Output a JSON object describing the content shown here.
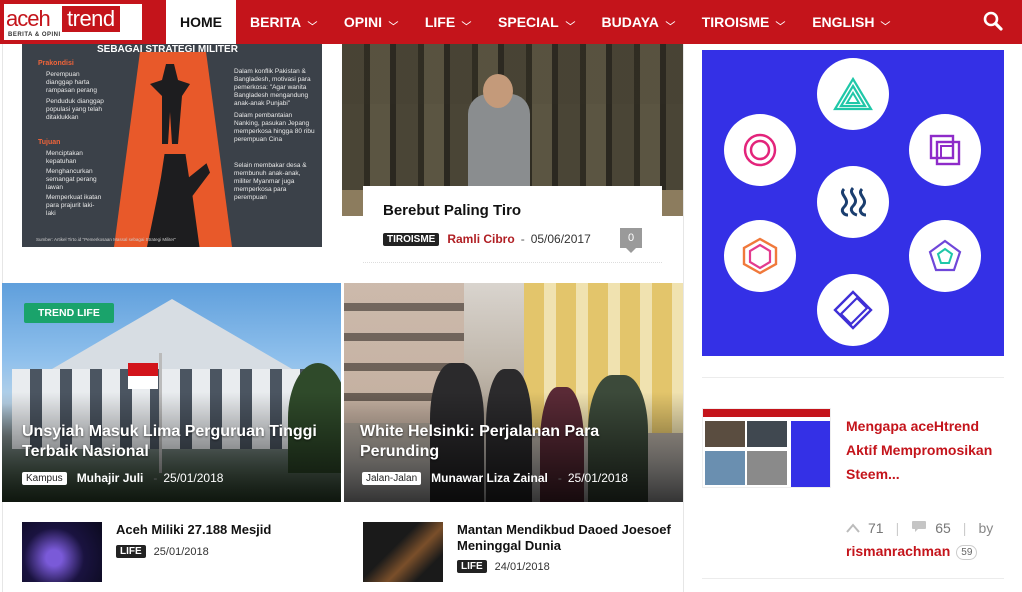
{
  "logo": {
    "part1": "aceh",
    "part2": "trend",
    "tagline": "BERITA & OPINI"
  },
  "nav": {
    "items": [
      {
        "label": "HOME"
      },
      {
        "label": "BERITA"
      },
      {
        "label": "OPINI"
      },
      {
        "label": "LIFE"
      },
      {
        "label": "SPECIAL"
      },
      {
        "label": "BUDAYA"
      },
      {
        "label": "TIROISME"
      },
      {
        "label": "ENGLISH"
      }
    ]
  },
  "infographic": {
    "title": "SEBAGAI STRATEGI MILITER",
    "heading_prakondisi": "Prakondisi",
    "prakondisi": [
      "Perempuan dianggap harta rampasan perang",
      "Penduduk dianggap populasi yang telah ditaklukkan"
    ],
    "heading_tujuan": "Tujuan",
    "tujuan": [
      "Menciptakan kepatuhan",
      "Menghancurkan semangat perang lawan",
      "Memperkuat ikatan para prajurit laki-laki"
    ],
    "right1": "Dalam konflik Pakistan & Bangladesh, motivasi para pemerkosa: \"Agar wanita Bangladesh mengandung anak-anak Punjabi\"",
    "right2": "Dalam pembantaian Nanking, pasukan Jepang memperkosa hingga 80 ribu perempuan Cina",
    "right3": "Selain membakar desa & membunuh anak-anak, militer Myanmar juga memperkosa para perempuan",
    "source": "Sumber: Artikel Tirto.id \"Pemerkosaan Massal sebagai Strategi Militer\""
  },
  "featured": {
    "title": "Berebut Paling Tiro",
    "category": "TIROISME",
    "author": "Ramli Cibro",
    "date": "05/06/2017",
    "comments": "0"
  },
  "tiles": [
    {
      "badge": "TREND LIFE",
      "title": "Unsyiah Masuk Lima Perguruan Tinggi Terbaik Nasional",
      "category": "Kampus",
      "author": "Muhajir Juli",
      "date": "25/01/2018"
    },
    {
      "title": "White Helsinki: Perjalanan Para Perunding",
      "category": "Jalan-Jalan",
      "author": "Munawar Liza Zainal",
      "date": "25/01/2018"
    }
  ],
  "small_posts": [
    {
      "title": "Aceh Miliki 27.188 Mesjid",
      "category": "LIFE",
      "date": "25/01/2018"
    },
    {
      "title": "Mantan Mendikbud Daoed Joesoef Meninggal Dunia",
      "category": "LIFE",
      "date": "24/01/2018"
    }
  ],
  "sidebar_post": {
    "title": "Mengapa aceHtrend Aktif Mempromosikan Steem...",
    "upvotes": "71",
    "comments": "65",
    "by_label": "by",
    "author": "rismanrachman",
    "reputation": "59"
  },
  "colors": {
    "brand_red": "#c4141b",
    "steem_blue": "#3430e6",
    "trend_green": "#1aa36b"
  }
}
